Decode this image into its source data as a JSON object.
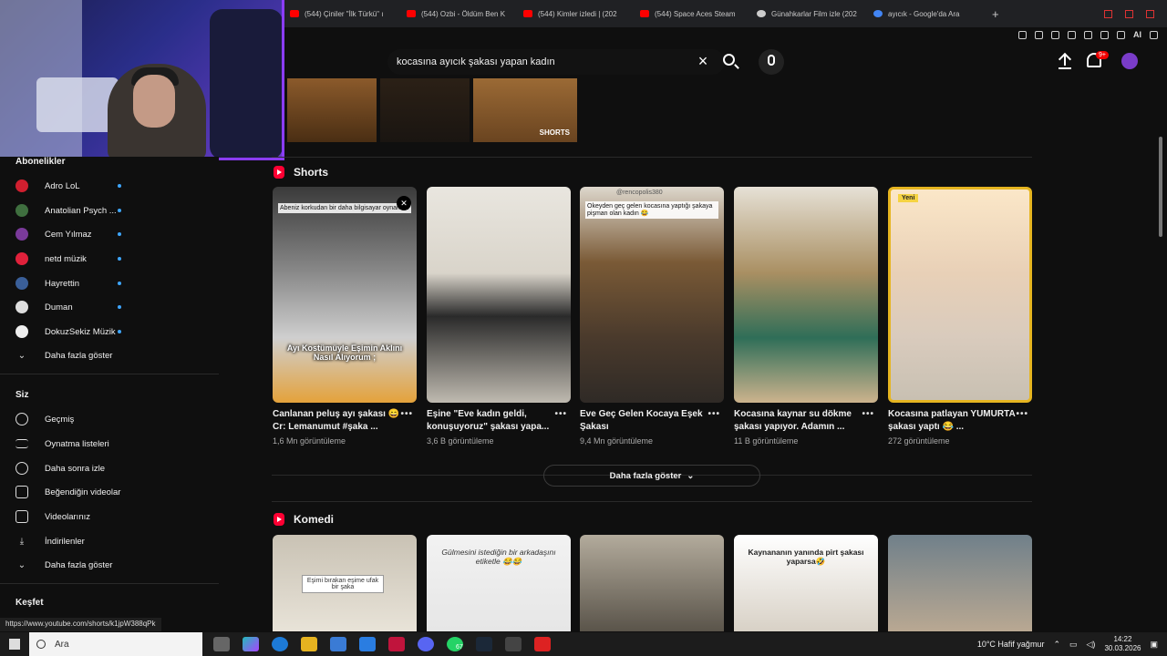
{
  "browser": {
    "tabs": [
      {
        "label": "(544) Çiniler \"İlk Türkü\" ı",
        "icon": "youtube"
      },
      {
        "label": "(544) Ozbi - Öldüm Ben K",
        "icon": "youtube"
      },
      {
        "label": "(544) Kimler izledi | (202",
        "icon": "youtube"
      },
      {
        "label": "(544) Space Aces Steam",
        "icon": "youtube"
      },
      {
        "label": "Günahkarlar Film izle (202",
        "icon": "film"
      },
      {
        "label": "ayıcık - Google'da Ara",
        "icon": "google"
      }
    ],
    "new_tab": "+",
    "ext_ai": "AI",
    "status_url": "https://www.youtube.com/shorts/k1jpW388qPk"
  },
  "header": {
    "search_query": "kocasına ayıcık şakası yapan kadın",
    "notif_count": "9+"
  },
  "top_thumbs": {
    "shorts_label": "SHORTS"
  },
  "sidebar": {
    "subscriptions_title": "Abonelikler",
    "subscriptions": [
      {
        "label": "Adro LoL",
        "color": "#d01f2f"
      },
      {
        "label": "Anatolian Psych ...",
        "color": "#3f6f3f"
      },
      {
        "label": "Cem Yılmaz",
        "color": "#7a3a9a"
      },
      {
        "label": "netd müzik",
        "color": "#e0213b"
      },
      {
        "label": "Hayrettin",
        "color": "#3a5f99"
      },
      {
        "label": "Duman",
        "color": "#dddddd"
      },
      {
        "label": "DokuzSekiz Müzik",
        "color": "#eeeeee"
      }
    ],
    "show_more": "Daha fazla göster",
    "you_title": "Siz",
    "you_items": [
      {
        "label": "Geçmiş",
        "icon": "history-icon"
      },
      {
        "label": "Oynatma listeleri",
        "icon": "playlist-icon"
      },
      {
        "label": "Daha sonra izle",
        "icon": "clock-icon"
      },
      {
        "label": "Beğendiğin videolar",
        "icon": "like-icon"
      },
      {
        "label": "Videolarınız",
        "icon": "video-icon"
      },
      {
        "label": "İndirilenler",
        "icon": "download-icon"
      }
    ],
    "show_more_2": "Daha fazla göster",
    "explore_title": "Keşfet"
  },
  "shorts_shelf": {
    "title": "Shorts",
    "items": [
      {
        "title": "Canlanan peluş ayı şakası 😄 Cr: Lemanumut #şaka ...",
        "views": "1,6 Mn görüntüleme",
        "overlay": "Ayı Kostümüyle Eşimin Aklını Nasıl Alıyorum ;",
        "top_text": "Abeniz korkudan bir daha bilgisayar oynamaz"
      },
      {
        "title": "Eşine \"Eve kadın geldi, konuşuyoruz\" şakası yapa...",
        "views": "3,6 B görüntüleme"
      },
      {
        "title": "Eve Geç Gelen Kocaya Eşek Şakası",
        "views": "9,4 Mn görüntüleme",
        "handle": "@rencopolis380",
        "top_text": "Okeyden geç gelen kocasına yaptığı şakaya pişman olan kadın 😂"
      },
      {
        "title": "Kocasına kaynar su dökme şakası yapıyor. Adamın ...",
        "views": "11 B görüntüleme"
      },
      {
        "title": "Kocasına patlayan YUMURTA şakası yaptı 😂 ...",
        "views": "272 görüntüleme",
        "badge": "Yeni"
      }
    ],
    "show_more": "Daha fazla göster"
  },
  "komedi_shelf": {
    "title": "Komedi",
    "items": [
      {
        "text": "Eşimi bırakan eşime ufak bir şaka"
      },
      {
        "text": "Gülmesini istediğin bir arkadaşını etiketle 😂😂"
      },
      {
        "text": ""
      },
      {
        "text": "Kaynananın yanında pirt şakası yaparsa🤣"
      },
      {
        "text": ""
      }
    ]
  },
  "taskbar": {
    "search_placeholder": "Ara",
    "weather": "10°C  Hafif yağmur",
    "time": "14:22",
    "date": "30.03.2026",
    "badge_count": "67"
  }
}
